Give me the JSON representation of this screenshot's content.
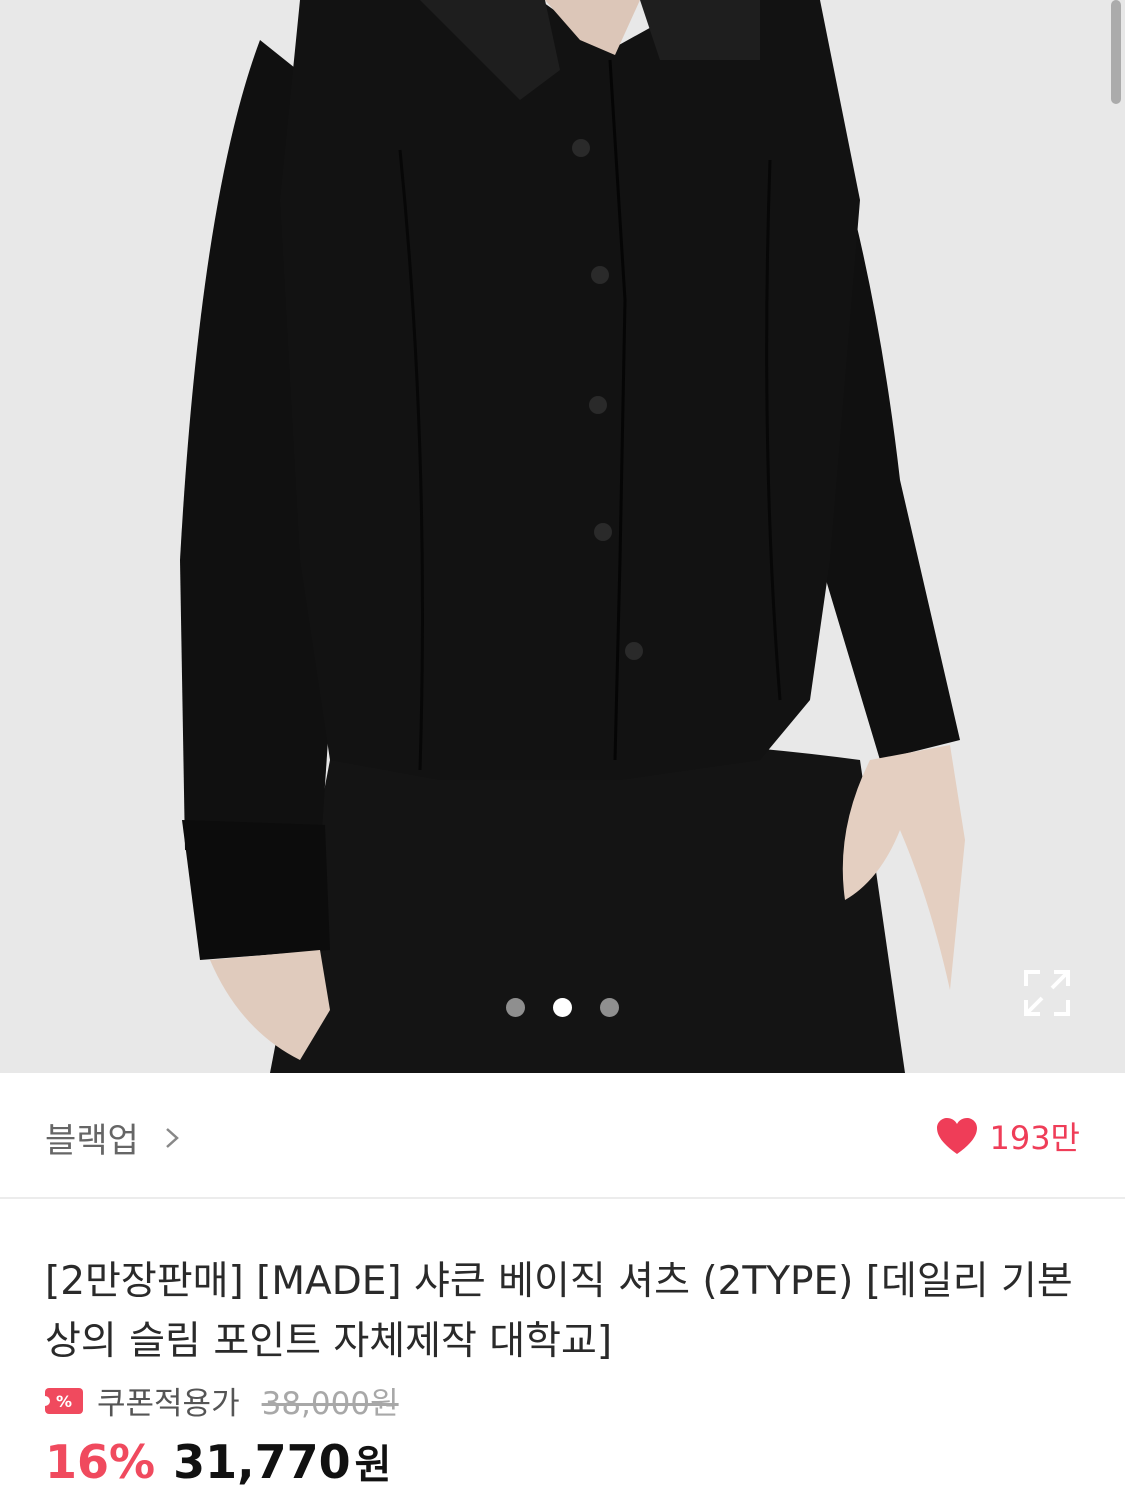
{
  "gallery": {
    "image_alt": "black slim button-up shirt",
    "dots": [
      {
        "active": false
      },
      {
        "active": true
      },
      {
        "active": false
      }
    ],
    "expand_icon": "expand-icon"
  },
  "brand": {
    "name": "블랙업",
    "chevron": ">"
  },
  "likes": {
    "icon": "heart-icon",
    "count": "193만",
    "color": "#ef3d58"
  },
  "product": {
    "title": "[2만장판매] [MADE] 샤큰 베이직 셔츠 (2TYPE) [데일리 기본 상의 슬림 포인트 자체제작 대학교]",
    "coupon_label": "쿠폰적용가",
    "original_price": "38,000원",
    "discount": "16%",
    "price": "31,770",
    "currency": "원",
    "accent_color": "#f04a5e"
  }
}
